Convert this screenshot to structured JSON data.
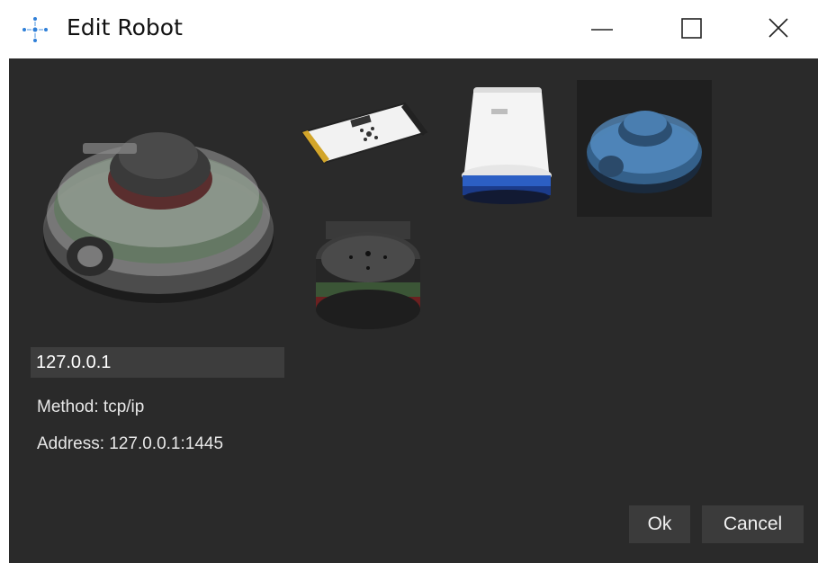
{
  "window": {
    "title": "Edit Robot",
    "app_icon": "robot-crosshair-icon",
    "controls": [
      "minimize-icon",
      "maximize-icon",
      "close-icon"
    ]
  },
  "robots": [
    {
      "name": "robot-thumbnail-turtlebot"
    },
    {
      "name": "robot-thumbnail-controller-board"
    },
    {
      "name": "robot-thumbnail-white-tower"
    },
    {
      "name": "robot-thumbnail-turtlebot-selected"
    },
    {
      "name": "robot-thumbnail-round-base"
    }
  ],
  "connection": {
    "ip_value": "127.0.0.1",
    "method_text": "Method: tcp/ip",
    "address_text": "Address: 127.0.0.1:1445"
  },
  "buttons": {
    "ok": "Ok",
    "cancel": "Cancel"
  },
  "colors": {
    "dialog_bg": "#2a2a2a",
    "input_bg": "#3d3d3d",
    "button_bg": "#3b3b3b",
    "selected_highlight": "#4a90d9"
  }
}
